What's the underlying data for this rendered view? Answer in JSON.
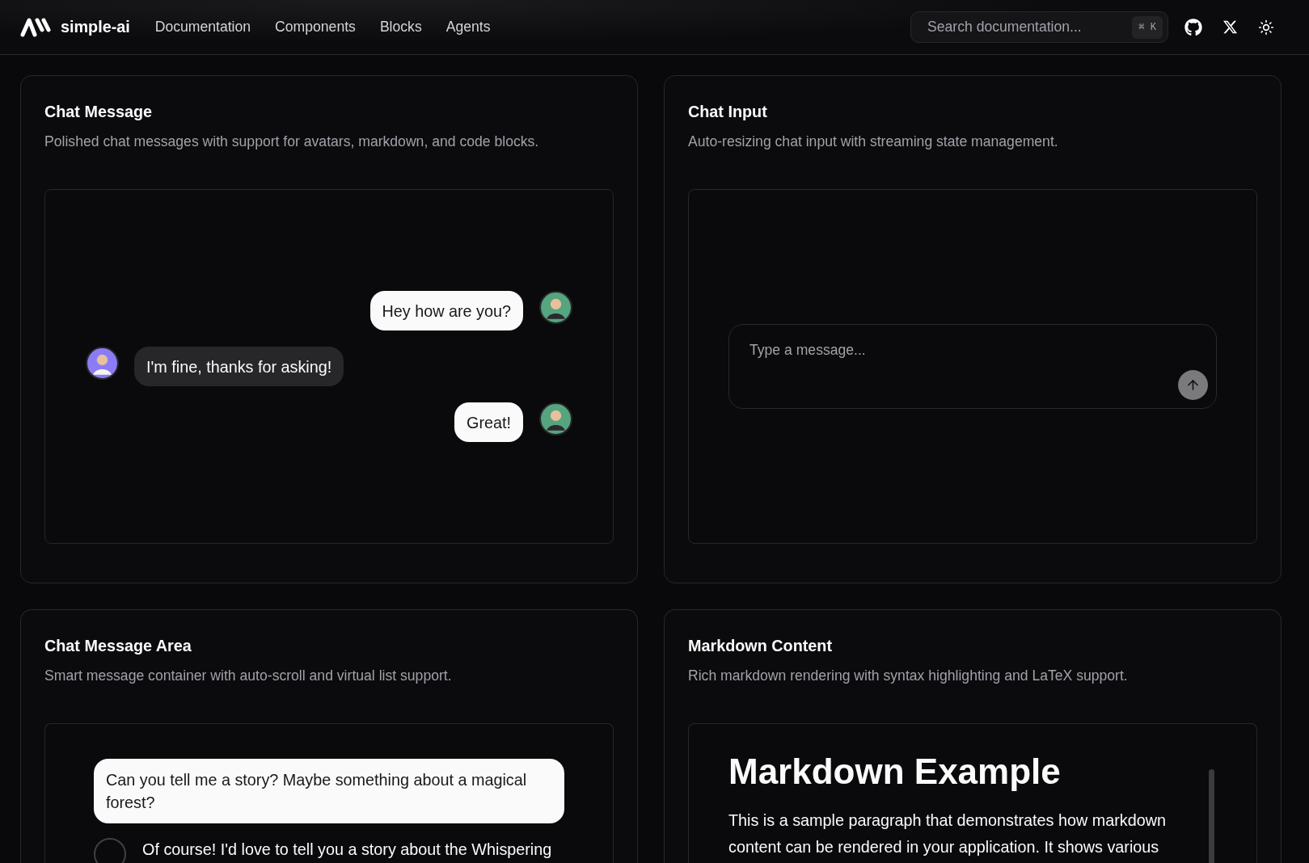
{
  "header": {
    "logo_text": "simple-ai",
    "nav": [
      "Documentation",
      "Components",
      "Blocks",
      "Agents"
    ],
    "search": {
      "placeholder": "Search documentation...",
      "shortcut": "⌘ K"
    }
  },
  "cards": [
    {
      "title": "Chat Message",
      "description": "Polished chat messages with support for avatars, markdown, and code blocks.",
      "preview": {
        "kind": "chat_message",
        "messages": [
          {
            "kind": "user",
            "text": "Hey how are you?"
          },
          {
            "kind": "assistant",
            "text": "I'm fine, thanks for asking!"
          },
          {
            "kind": "user",
            "text": "Great!"
          }
        ]
      }
    },
    {
      "title": "Chat Input",
      "description": "Auto-resizing chat input with streaming state management.",
      "preview": {
        "kind": "chat_input",
        "placeholder": "Type a message..."
      }
    },
    {
      "title": "Chat Message Area",
      "description": "Smart message container with auto-scroll and virtual list support.",
      "preview": {
        "kind": "chat_message_area",
        "messages": [
          {
            "kind": "user",
            "text": "Can you tell me a story? Maybe something about a magical forest?"
          },
          {
            "kind": "assistant",
            "text": "Of course! I'd love to tell you a story about the Whispering"
          }
        ]
      }
    },
    {
      "title": "Markdown Content",
      "description": "Rich markdown rendering with syntax highlighting and LaTeX support.",
      "preview": {
        "kind": "markdown",
        "heading": "Markdown Example",
        "paragraph": "This is a sample paragraph that demonstrates how markdown content can be rendered in your application. It shows various"
      }
    }
  ]
}
